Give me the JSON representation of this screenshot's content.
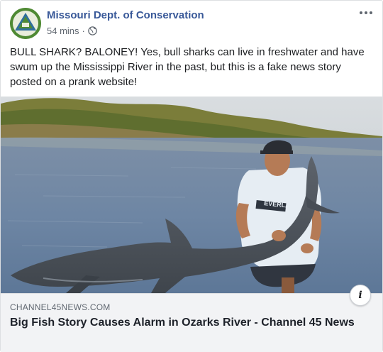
{
  "post": {
    "page_name": "Missouri Dept. of Conservation",
    "time": "54 mins",
    "separator": "·",
    "privacy_icon": "globe-icon",
    "more_icon": "more-options-icon",
    "text": "BULL SHARK? BALONEY! Yes, bull sharks can live in freshwater and have swum up the Mississippi River in the past, but this is a fake news story posted on a prank website!",
    "shirt_text": "EVERLAST"
  },
  "link_preview": {
    "domain": "CHANNEL45NEWS.COM",
    "title": "Big Fish Story Causes Alarm in Ozarks River - Channel 45 News",
    "info_icon_label": "i"
  },
  "colors": {
    "link_blue": "#385898",
    "meta_gray": "#606770",
    "preview_bg": "#f2f3f5",
    "water": "#6f88a6",
    "trees": "#6b7a3a"
  }
}
